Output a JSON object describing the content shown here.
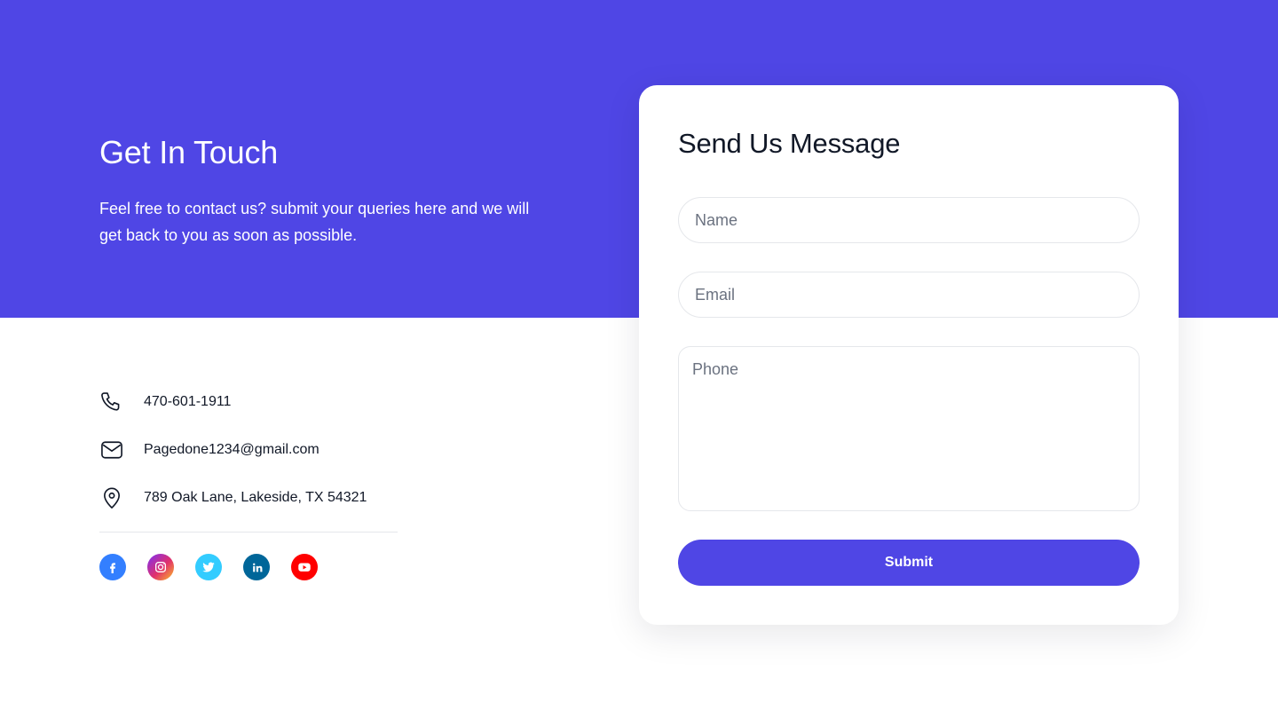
{
  "hero": {
    "title": "Get In Touch",
    "description": "Feel free to contact us? submit your queries here and we will get back to you as soon as possible."
  },
  "contact": {
    "phone": "470-601-1911",
    "email": "Pagedone1234@gmail.com",
    "address": "789 Oak Lane, Lakeside, TX 54321"
  },
  "socials": [
    {
      "name": "facebook-icon",
      "color": "#337FFF"
    },
    {
      "name": "instagram-icon",
      "color": "#E1306C"
    },
    {
      "name": "twitter-icon",
      "color": "#33CCFF"
    },
    {
      "name": "linkedin-icon",
      "color": "#006699"
    },
    {
      "name": "youtube-icon",
      "color": "#FF0000"
    }
  ],
  "form": {
    "title": "Send Us Message",
    "name_placeholder": "Name",
    "email_placeholder": "Email",
    "phone_placeholder": "Phone",
    "submit_label": "Submit"
  },
  "colors": {
    "accent": "#4f46e5"
  }
}
